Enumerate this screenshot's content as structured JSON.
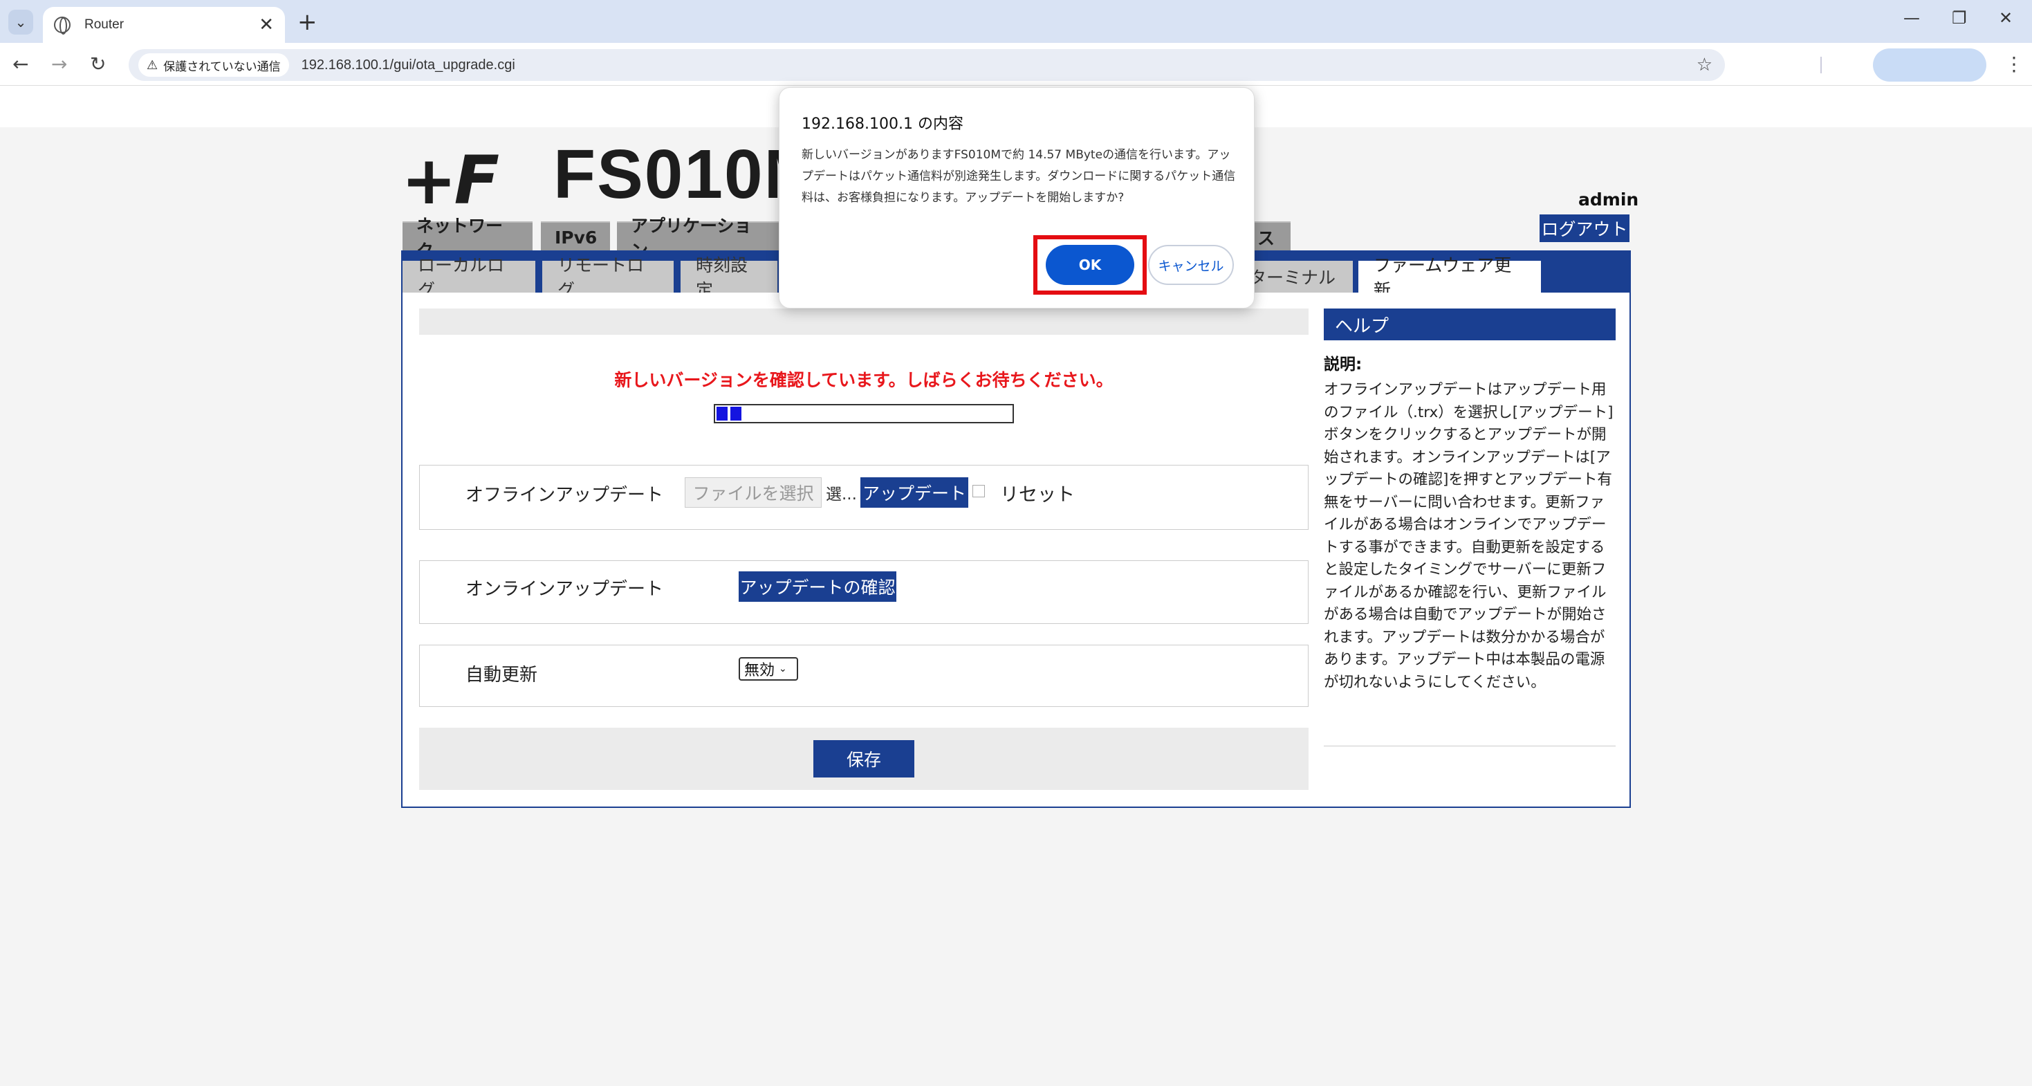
{
  "browser": {
    "tab_title": "Router",
    "tab_close": "✕",
    "new_tab": "+",
    "security_label": "保護されていない通信",
    "url": "192.168.100.1/gui/ota_upgrade.cgi"
  },
  "router": {
    "logo": "+F",
    "model": "FS010M",
    "user": "admin",
    "logout_label": "ログアウト",
    "main_tabs": [
      {
        "label": "ネットワーク"
      },
      {
        "label": "IPv6"
      },
      {
        "label": "アプリケーション"
      },
      {
        "label": "ス"
      }
    ],
    "sub_tabs": [
      {
        "label": "ローカルログ"
      },
      {
        "label": "リモートログ"
      },
      {
        "label": "時刻設定"
      },
      {
        "label": "ターミナル"
      },
      {
        "label": "ファームウェア更新"
      }
    ],
    "checking_message": "新しいバージョンを確認しています。しばらくお待ちください。",
    "offline": {
      "label": "オフラインアップデート",
      "file_button": "ファイルを選択",
      "file_hint": "選...",
      "update_button": "アップデート",
      "reset_label": "リセット"
    },
    "online": {
      "label": "オンラインアップデート",
      "check_button": "アップデートの確認"
    },
    "auto_update": {
      "label": "自動更新",
      "selected": "無効"
    },
    "save_button": "保存",
    "help": {
      "title": "ヘルプ",
      "subtitle": "説明:",
      "text": "オフラインアップデートはアップデート用のファイル（.trx）を選択し[アップデート]ボタンをクリックするとアップデートが開始されます。オンラインアップデートは[アップデートの確認]を押すとアップデート有無をサーバーに問い合わせます。更新ファイルがある場合はオンラインでアップデートする事ができます。自動更新を設定すると設定したタイミングでサーバーに更新ファイルがあるか確認を行い、更新ファイルがある場合は自動でアップデートが開始されます。アップデートは数分かかる場合があります。アップデート中は本製品の電源が切れないようにしてください。"
    }
  },
  "dialog": {
    "title": "192.168.100.1 の内容",
    "message": "新しいバージョンがありますFS010Mで約 14.57 MByteの通信を行います。アップデートはパケット通信料が別途発生します。ダウンロードに関するパケット通信料は、お客様負担になります。アップデートを開始しますか?",
    "ok_label": "OK",
    "cancel_label": "キャンセル"
  },
  "progress_fraction": 0.12
}
